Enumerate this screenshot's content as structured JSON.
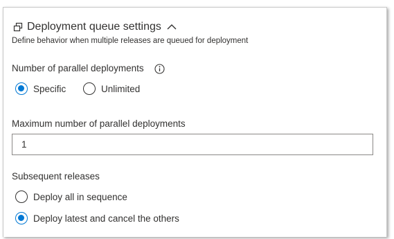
{
  "section": {
    "title": "Deployment queue settings",
    "description": "Define behavior when multiple releases are queued for deployment"
  },
  "parallel": {
    "label": "Number of parallel deployments",
    "options": [
      {
        "label": "Specific",
        "checked": true
      },
      {
        "label": "Unlimited",
        "checked": false
      }
    ]
  },
  "max_parallel": {
    "label": "Maximum number of parallel deployments",
    "value": "1"
  },
  "subsequent": {
    "label": "Subsequent releases",
    "options": [
      {
        "label": "Deploy all in sequence",
        "checked": false
      },
      {
        "label": "Deploy latest and cancel the others",
        "checked": true
      }
    ]
  },
  "colors": {
    "accent": "#0078d4",
    "text": "#323130",
    "border": "#8a8886"
  },
  "icons": {
    "section": "queue-icon",
    "collapse": "chevron-up-icon",
    "info": "info-icon"
  }
}
